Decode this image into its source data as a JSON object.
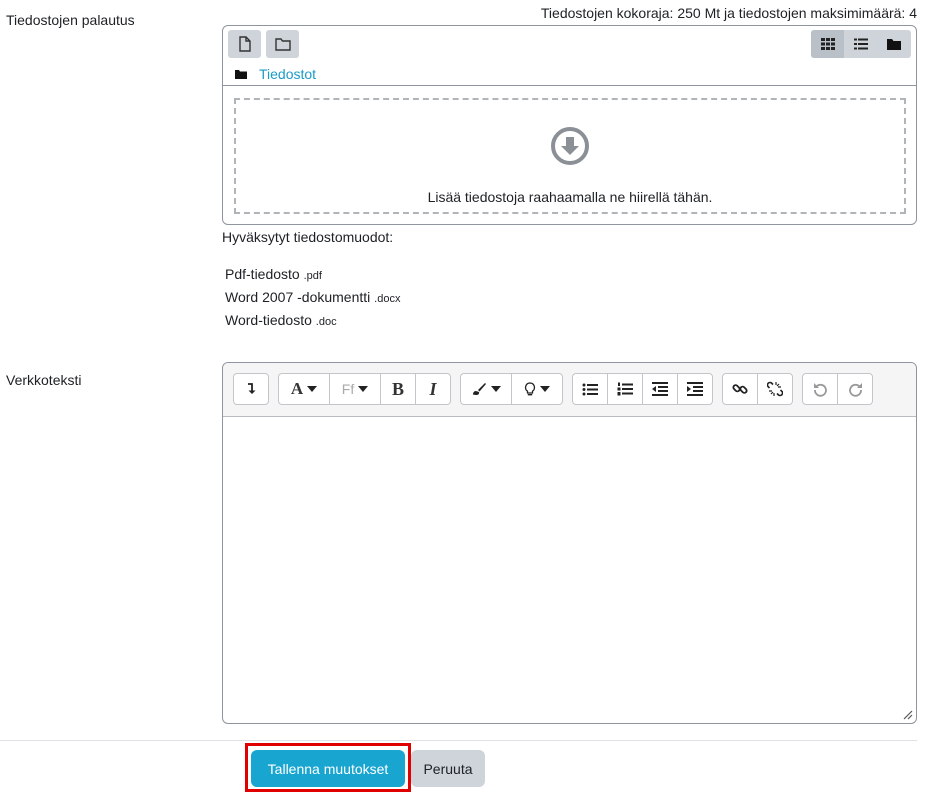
{
  "submission": {
    "label": "Tiedostojen palautus",
    "limits": "Tiedostojen kokoraja: 250 Mt ja tiedostojen maksimimäärä: 4",
    "path_label": "Tiedostot",
    "drop_text": "Lisää tiedostoja raahaamalla ne hiirellä tähän.",
    "accepted_title": "Hyväksytyt tiedostomuodot:",
    "filetypes": [
      {
        "name": "Pdf-tiedosto",
        "ext": ".pdf"
      },
      {
        "name": "Word 2007 -dokumentti",
        "ext": ".docx"
      },
      {
        "name": "Word-tiedosto",
        "ext": ".doc"
      }
    ]
  },
  "onlinetext": {
    "label": "Verkkoteksti",
    "toolbar": {
      "bold": "B",
      "italic": "I",
      "font": "A",
      "fontsize": "Ff"
    }
  },
  "actions": {
    "save_label": "Tallenna muutokset",
    "cancel_label": "Peruuta"
  },
  "colors": {
    "primary": "#18a5d0",
    "secondary": "#ced4da",
    "link": "#1a9bc6",
    "highlight": "#e00000"
  },
  "icons": [
    "add-file-icon",
    "create-folder-icon",
    "icon-view-icon",
    "list-view-icon",
    "tree-view-icon",
    "folder-icon",
    "download-arrow-icon",
    "expand-toolbar-icon",
    "unordered-list-icon",
    "ordered-list-icon",
    "outdent-icon",
    "indent-icon",
    "link-icon",
    "unlink-icon",
    "undo-icon",
    "redo-icon",
    "resize-handle-icon"
  ]
}
